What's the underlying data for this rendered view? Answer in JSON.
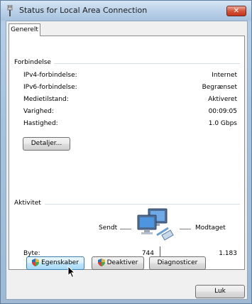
{
  "window": {
    "title": "Status for Local Area Connection",
    "close_label": "✕"
  },
  "tabs": [
    {
      "label": "Generelt"
    }
  ],
  "connection": {
    "group_label": "Forbindelse",
    "rows": [
      {
        "label": "IPv4-forbindelse:",
        "value": "Internet"
      },
      {
        "label": "IPv6-forbindelse:",
        "value": "Begrænset"
      },
      {
        "label": "Medietilstand:",
        "value": "Aktiveret"
      },
      {
        "label": "Varighed:",
        "value": "00:09:05"
      },
      {
        "label": "Hastighed:",
        "value": "1.0 Gbps"
      }
    ],
    "details_button": "Detaljer..."
  },
  "activity": {
    "group_label": "Aktivitet",
    "sent_label": "Sendt",
    "received_label": "Modtaget",
    "bytes_label": "Byte:",
    "bytes_sent": "744",
    "bytes_received": "1.183"
  },
  "actions": {
    "properties": "Egenskaber",
    "disable": "Deaktiver",
    "diagnose": "Diagnosticer"
  },
  "footer": {
    "close_button": "Luk"
  },
  "icons": {
    "title": "network-connector-icon",
    "activity": "network-computers-icon",
    "shield": "uac-shield-icon",
    "cursor": "mouse-pointer-icon"
  }
}
